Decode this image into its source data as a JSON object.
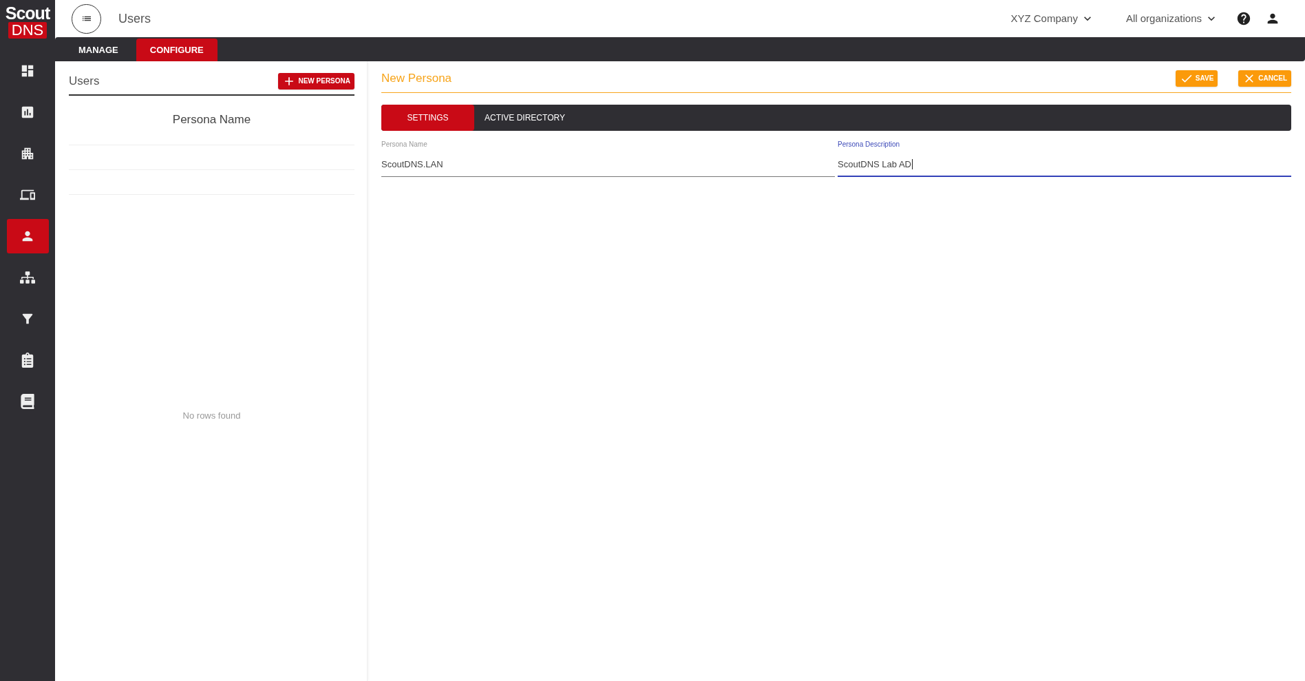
{
  "logo": {
    "line1": "Scout",
    "line2": "DNS"
  },
  "sidebar": {
    "items": [
      {
        "kind": "dashboard",
        "selected": false
      },
      {
        "kind": "chart",
        "selected": false
      },
      {
        "kind": "building",
        "selected": false
      },
      {
        "kind": "devices",
        "selected": false
      },
      {
        "kind": "person",
        "selected": true
      },
      {
        "kind": "sitemap",
        "selected": false
      },
      {
        "kind": "filter",
        "selected": false
      },
      {
        "kind": "clipboard",
        "selected": false
      },
      {
        "kind": "book",
        "selected": false
      }
    ]
  },
  "header": {
    "title": "Users",
    "company": "XYZ Company",
    "organization": "All organizations"
  },
  "nav_tabs": [
    {
      "label": "MANAGE",
      "selected": false
    },
    {
      "label": "CONFIGURE",
      "selected": true
    }
  ],
  "list_panel": {
    "title": "Users",
    "new_button": "NEW PERSONA",
    "column": "Persona Name",
    "empty_text": "No rows found"
  },
  "editor": {
    "title": "New Persona",
    "save": "SAVE",
    "cancel": "CANCEL",
    "tabs": [
      {
        "label": "SETTINGS",
        "selected": true
      },
      {
        "label": "ACTIVE DIRECTORY",
        "selected": false
      }
    ],
    "fields": [
      {
        "label": "Persona Name",
        "value": "ScoutDNS.LAN",
        "focused": false
      },
      {
        "label": "Persona Description",
        "value": "ScoutDNS Lab AD",
        "focused": true
      }
    ]
  }
}
